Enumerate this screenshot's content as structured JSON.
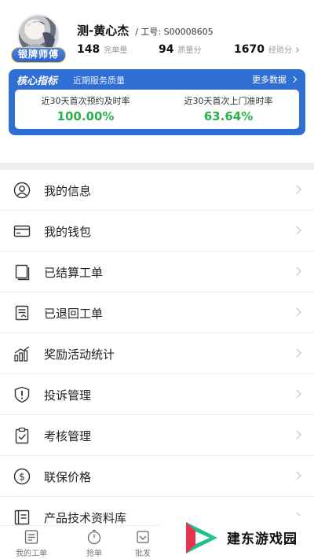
{
  "profile": {
    "badge": "银牌师傅",
    "name": "测-黄心杰",
    "staff_id": "/ 工号: S00008605",
    "stats": [
      {
        "value": "148",
        "label": "完单量"
      },
      {
        "value": "94",
        "label": "质量分"
      },
      {
        "value": "1670",
        "label": "经验分"
      }
    ]
  },
  "core": {
    "title": "核心指标",
    "subtitle": "近期服务质量",
    "more": "更多数据",
    "metrics": [
      {
        "label": "近30天首次预约及时率",
        "value": "100.00%"
      },
      {
        "label": "近30天首次上门准时率",
        "value": "63.64%"
      }
    ],
    "colors": {
      "accent": "#2f6ed2",
      "value": "#27b24a"
    }
  },
  "menu": [
    {
      "label": "我的信息",
      "icon": "user-circle-icon"
    },
    {
      "label": "我的钱包",
      "icon": "wallet-icon"
    },
    {
      "label": "已结算工单",
      "icon": "settled-orders-icon"
    },
    {
      "label": "已退回工单",
      "icon": "returned-orders-icon"
    },
    {
      "label": "奖励活动统计",
      "icon": "stats-chart-icon"
    },
    {
      "label": "投诉管理",
      "icon": "complaint-shield-icon"
    },
    {
      "label": "考核管理",
      "icon": "clipboard-check-icon"
    },
    {
      "label": "联保价格",
      "icon": "dollar-circle-icon"
    },
    {
      "label": "产品技术资料库",
      "icon": "document-library-icon"
    }
  ],
  "bottom_nav": [
    {
      "label": "我的工单",
      "icon": "orders-icon"
    },
    {
      "label": "抢单",
      "icon": "stopwatch-icon"
    },
    {
      "label": "批发",
      "icon": "wholesale-icon"
    }
  ],
  "watermark": {
    "text": "建东游戏园"
  }
}
